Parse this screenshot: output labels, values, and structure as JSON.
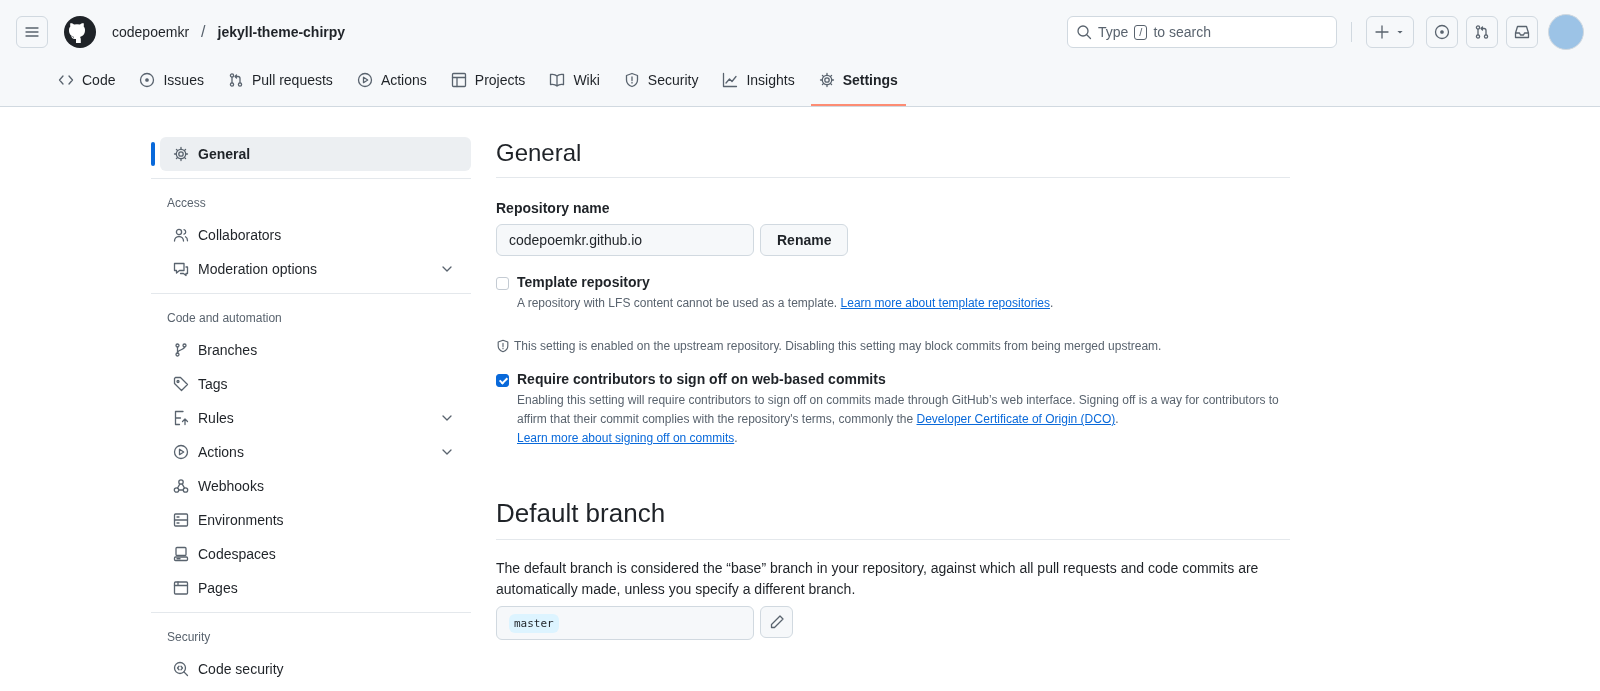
{
  "header": {
    "owner": "codepoemkr",
    "separator": "/",
    "repo": "jekyll-theme-chirpy",
    "search": {
      "before": "Type",
      "key": "/",
      "after": "to search"
    }
  },
  "repo_tabs": [
    {
      "label": "Code",
      "selected": false
    },
    {
      "label": "Issues",
      "selected": false
    },
    {
      "label": "Pull requests",
      "selected": false
    },
    {
      "label": "Actions",
      "selected": false
    },
    {
      "label": "Projects",
      "selected": false
    },
    {
      "label": "Wiki",
      "selected": false
    },
    {
      "label": "Security",
      "selected": false
    },
    {
      "label": "Insights",
      "selected": false
    },
    {
      "label": "Settings",
      "selected": true
    }
  ],
  "sidebar": {
    "groups": [
      {
        "items": [
          {
            "label": "General",
            "kind": "link",
            "selected": true
          }
        ]
      },
      {
        "heading": "Access",
        "items": [
          {
            "label": "Collaborators",
            "kind": "link",
            "selected": false
          },
          {
            "label": "Moderation options",
            "kind": "menu",
            "selected": false
          }
        ]
      },
      {
        "heading": "Code and automation",
        "items": [
          {
            "label": "Branches",
            "kind": "link",
            "selected": false
          },
          {
            "label": "Tags",
            "kind": "link",
            "selected": false
          },
          {
            "label": "Rules",
            "kind": "menu",
            "selected": false
          },
          {
            "label": "Actions",
            "kind": "menu",
            "selected": false
          },
          {
            "label": "Webhooks",
            "kind": "link",
            "selected": false
          },
          {
            "label": "Environments",
            "kind": "link",
            "selected": false
          },
          {
            "label": "Codespaces",
            "kind": "link",
            "selected": false
          },
          {
            "label": "Pages",
            "kind": "link",
            "selected": false
          }
        ]
      },
      {
        "heading": "Security",
        "items": [
          {
            "label": "Code security",
            "kind": "link",
            "selected": false
          }
        ]
      }
    ]
  },
  "general": {
    "title": "General",
    "repo_name_label": "Repository name",
    "repo_name_value": "codepoemkr.github.io",
    "rename_button": "Rename",
    "template": {
      "label": "Template repository",
      "checked": false,
      "description": [
        {
          "kind": "text",
          "text": "A repository with LFS content cannot be used as a template. "
        },
        {
          "kind": "link",
          "text": "Learn more about template repositories"
        },
        {
          "kind": "text",
          "text": "."
        }
      ]
    },
    "notice": "This setting is enabled on the upstream repository. Disabling this setting may block commits from being merged upstream.",
    "signoff": {
      "label": "Require contributors to sign off on web-based commits",
      "checked": true,
      "description": [
        {
          "kind": "text",
          "text": "Enabling this setting will require contributors to sign off on commits made through GitHub’s web interface. Signing off is a way for contributors to affirm that their commit complies with the repository's terms, commonly the "
        },
        {
          "kind": "link",
          "text": "Developer Certificate of Origin (DCO)"
        },
        {
          "kind": "text",
          "text": ". "
        },
        {
          "kind": "link",
          "text": "Learn more about signing off on commits"
        },
        {
          "kind": "text",
          "text": "."
        }
      ]
    }
  },
  "default_branch": {
    "title": "Default branch",
    "description": "The default branch is considered the “base” branch in your repository, against which all pull requests and code commits are automatically made, unless you specify a different branch.",
    "branch": "master"
  }
}
